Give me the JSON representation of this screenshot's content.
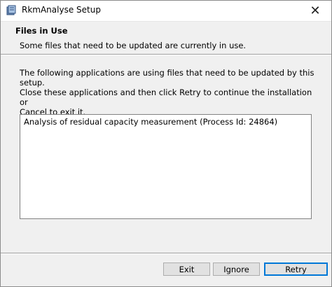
{
  "window": {
    "title": "RkmAnalyse Setup",
    "close_glyph": "✕"
  },
  "header": {
    "title": "Files in Use",
    "subtitle": "Some files that need to be updated are currently in use."
  },
  "body": {
    "description_line1": "The following applications are using files that need to be updated by this setup.",
    "description_line2": "Close these applications and then click Retry to continue the installation or",
    "description_line3": "Cancel to exit it."
  },
  "list": {
    "items": [
      "Analysis of residual capacity measurement (Process Id: 24864)"
    ]
  },
  "buttons": {
    "exit": "Exit",
    "ignore": "Ignore",
    "retry": "Retry"
  },
  "colors": {
    "default_button_border": "#0078d7",
    "dialog_background": "#f0f0f0"
  },
  "icons": {
    "app": "installer-package-icon",
    "close": "close-icon"
  }
}
